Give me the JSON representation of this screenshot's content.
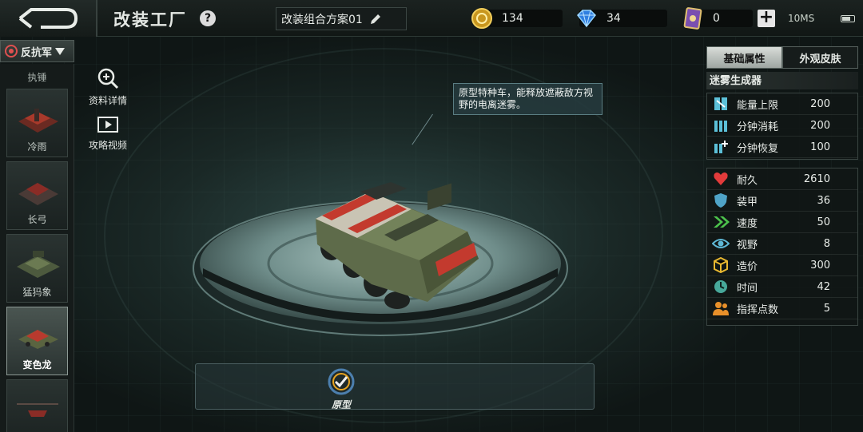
{
  "topbar": {
    "title": "改装工厂",
    "help": "?",
    "plan_name": "改装组合方案01",
    "gold": "134",
    "diamond": "34",
    "card": "0",
    "plus": "+",
    "network": "10MS"
  },
  "sidebar": {
    "faction": "反抗军",
    "top_label": "执锤",
    "units": [
      {
        "name": "冷雨",
        "selected": false
      },
      {
        "name": "长弓",
        "selected": false
      },
      {
        "name": "猛犸象",
        "selected": false
      },
      {
        "name": "变色龙",
        "selected": true
      },
      {
        "name": "",
        "selected": false
      }
    ]
  },
  "actions": {
    "details": "资料详情",
    "video": "攻略视频"
  },
  "tooltip": "原型特种车，能释放遮蔽敌方视野的电离迷雾。",
  "variant": {
    "label": "原型"
  },
  "panel": {
    "tabs": [
      "基础属性",
      "外观皮肤"
    ],
    "section": "迷雾生成器",
    "energy": [
      {
        "icon": "energy-cap-icon",
        "label": "能量上限",
        "value": "200"
      },
      {
        "icon": "energy-consume-icon",
        "label": "分钟消耗",
        "value": "200"
      },
      {
        "icon": "energy-recover-icon",
        "label": "分钟恢复",
        "value": "100"
      }
    ],
    "stats": [
      {
        "icon": "heart-icon",
        "label": "耐久",
        "value": "2610",
        "color": "#e23b3b"
      },
      {
        "icon": "shield-icon",
        "label": "装甲",
        "value": "36",
        "color": "#4fa3c7"
      },
      {
        "icon": "speed-icon",
        "label": "速度",
        "value": "50",
        "color": "#4cc24c"
      },
      {
        "icon": "eye-icon",
        "label": "视野",
        "value": "8",
        "color": "#5fb8d6"
      },
      {
        "icon": "cost-icon",
        "label": "造价",
        "value": "300",
        "color": "#e8b830"
      },
      {
        "icon": "clock-icon",
        "label": "时间",
        "value": "42",
        "color": "#47a89a"
      },
      {
        "icon": "command-icon",
        "label": "指挥点数",
        "value": "5",
        "color": "#e8902a"
      }
    ]
  }
}
